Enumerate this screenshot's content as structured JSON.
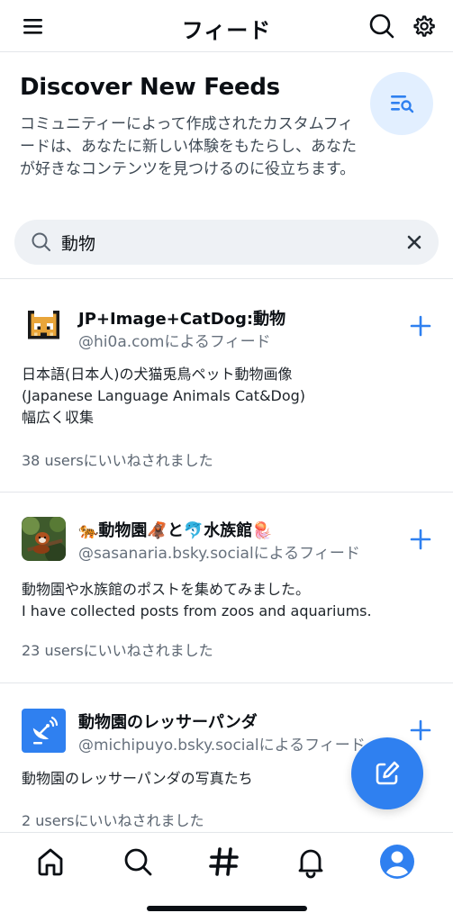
{
  "header": {
    "title": "フィード",
    "menu_icon": "menu-icon",
    "search_icon": "search-icon",
    "settings_icon": "gear-icon"
  },
  "discover": {
    "title": "Discover New Feeds",
    "description": "コミュニティーによって作成されたカスタムフィードは、あなたに新しい体験をもたらし、あなたが好きなコンテンツを見つけるのに役立ちます。",
    "badge_icon": "list-search-icon"
  },
  "search": {
    "value": "動物",
    "clear_icon": "close-icon"
  },
  "feeds": [
    {
      "name": "JP+Image+CatDog:動物",
      "by": "@hi0a.comによるフィード",
      "description": "日本語(日本人)の犬猫兎鳥ペット動物画像\n (Japanese Language Animals Cat&Dog)\n幅広く収集",
      "likes": "38 usersにいいねされました",
      "avatar_icon": "pixel-cat-avatar"
    },
    {
      "name": "🐅動物園🦧と🐬水族館🪼",
      "by": "@sasanaria.bsky.socialによるフィード",
      "description": "動物園や水族館のポストを集めてみました。\nI have collected posts from zoos and aquariums.",
      "likes": "23 usersにいいねされました",
      "avatar_icon": "red-panda-photo-avatar"
    },
    {
      "name": "動物園のレッサーパンダ",
      "by": "@michipuyo.bsky.socialによるフィード",
      "description": "動物園のレッサーパンダの写真たち",
      "likes": "2 usersにいいねされました",
      "avatar_icon": "satellite-dish-avatar"
    }
  ],
  "fab_icon": "compose-icon",
  "tabs": [
    "home-icon",
    "search-icon",
    "hashtag-icon",
    "notification-bell-icon",
    "profile-avatar-icon"
  ],
  "colors": {
    "accent": "#2f80f0",
    "badge_bg": "#e2efff",
    "search_bg": "#eef1f5"
  }
}
